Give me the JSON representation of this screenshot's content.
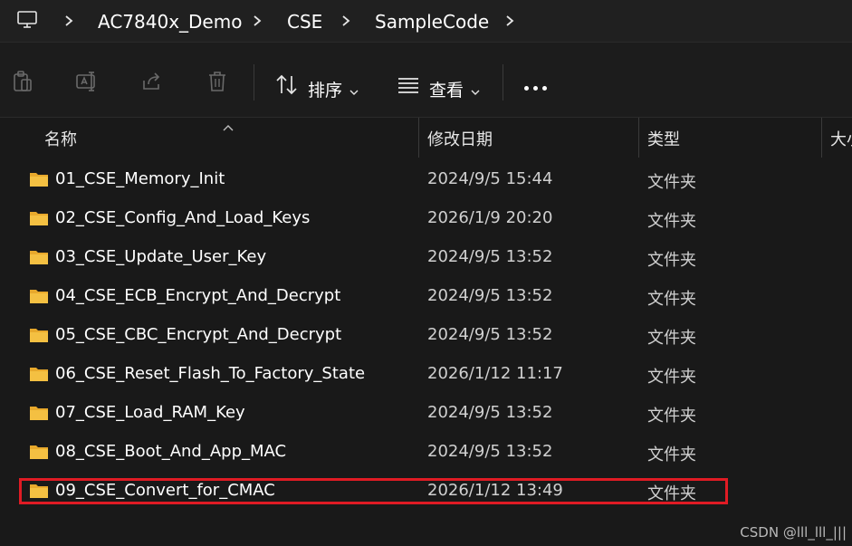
{
  "breadcrumb": {
    "icon": "computer-icon",
    "items": [
      "AC7840x_Demo",
      "CSE",
      "SampleCode"
    ]
  },
  "toolbar": {
    "icons": [
      "paste-icon",
      "rename-icon",
      "share-icon",
      "delete-icon"
    ],
    "sort_label": "排序",
    "view_label": "查看",
    "more_icon": "more-icon"
  },
  "columns": {
    "name": "名称",
    "date": "修改日期",
    "type": "类型",
    "size": "大小"
  },
  "files": [
    {
      "name": "01_CSE_Memory_Init",
      "date": "2024/9/5 15:44",
      "type": "文件夹"
    },
    {
      "name": "02_CSE_Config_And_Load_Keys",
      "date": "2026/1/9 20:20",
      "type": "文件夹"
    },
    {
      "name": "03_CSE_Update_User_Key",
      "date": "2024/9/5 13:52",
      "type": "文件夹"
    },
    {
      "name": "04_CSE_ECB_Encrypt_And_Decrypt",
      "date": "2024/9/5 13:52",
      "type": "文件夹"
    },
    {
      "name": "05_CSE_CBC_Encrypt_And_Decrypt",
      "date": "2024/9/5 13:52",
      "type": "文件夹"
    },
    {
      "name": "06_CSE_Reset_Flash_To_Factory_State",
      "date": "2026/1/12 11:17",
      "type": "文件夹"
    },
    {
      "name": "07_CSE_Load_RAM_Key",
      "date": "2024/9/5 13:52",
      "type": "文件夹"
    },
    {
      "name": "08_CSE_Boot_And_App_MAC",
      "date": "2024/9/5 13:52",
      "type": "文件夹"
    },
    {
      "name": "09_CSE_Convert_for_CMAC",
      "date": "2026/1/12 13:49",
      "type": "文件夹"
    }
  ],
  "highlight_color": "#e01b24",
  "folder_color": "#f4c042",
  "watermark": "CSDN @lll_lll_|||"
}
